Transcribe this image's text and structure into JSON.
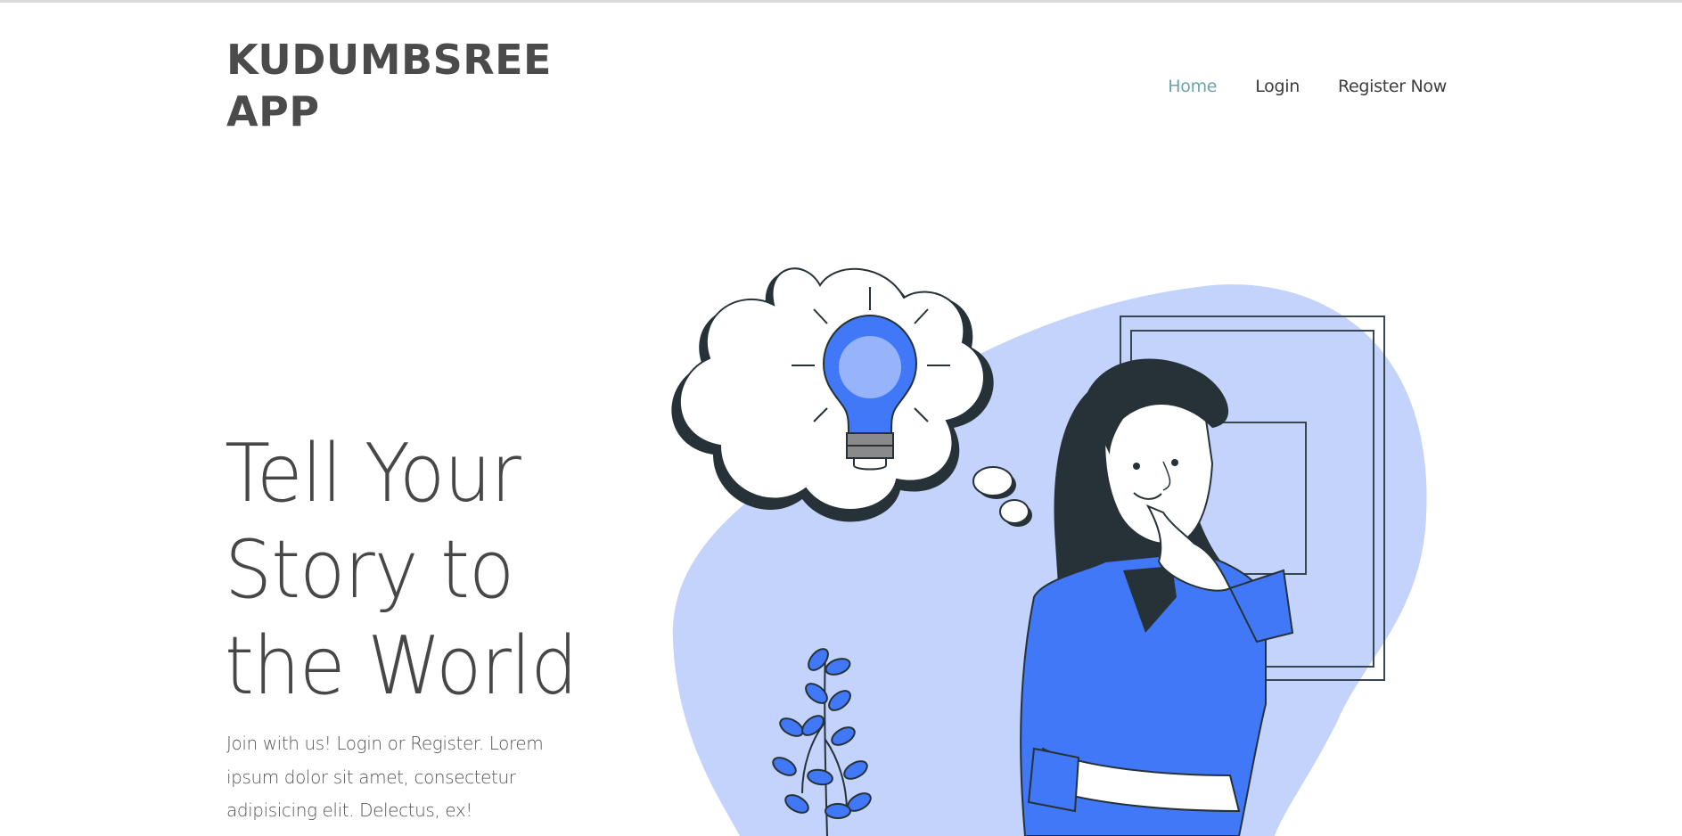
{
  "brand": {
    "title": "KUDUMBSREE APP"
  },
  "nav": {
    "items": [
      {
        "label": "Home",
        "active": true
      },
      {
        "label": "Login",
        "active": false
      },
      {
        "label": "Register Now",
        "active": false
      }
    ]
  },
  "hero": {
    "title": "Tell Your Story to the World",
    "description": "Join with us! Login or Register. Lorem ipsum dolor sit amet, consectetur adipisicing elit. Delectus, ex!"
  },
  "colors": {
    "accent": "#6fa3ab",
    "blob": "#c3d3fb",
    "blue": "#4178f7",
    "dark": "#263238",
    "text": "#474747"
  },
  "illustration": {
    "icons": [
      "thought-bubble-icon",
      "lightbulb-icon",
      "plant-icon",
      "picture-frame-icon",
      "woman-thinking-figure"
    ]
  }
}
